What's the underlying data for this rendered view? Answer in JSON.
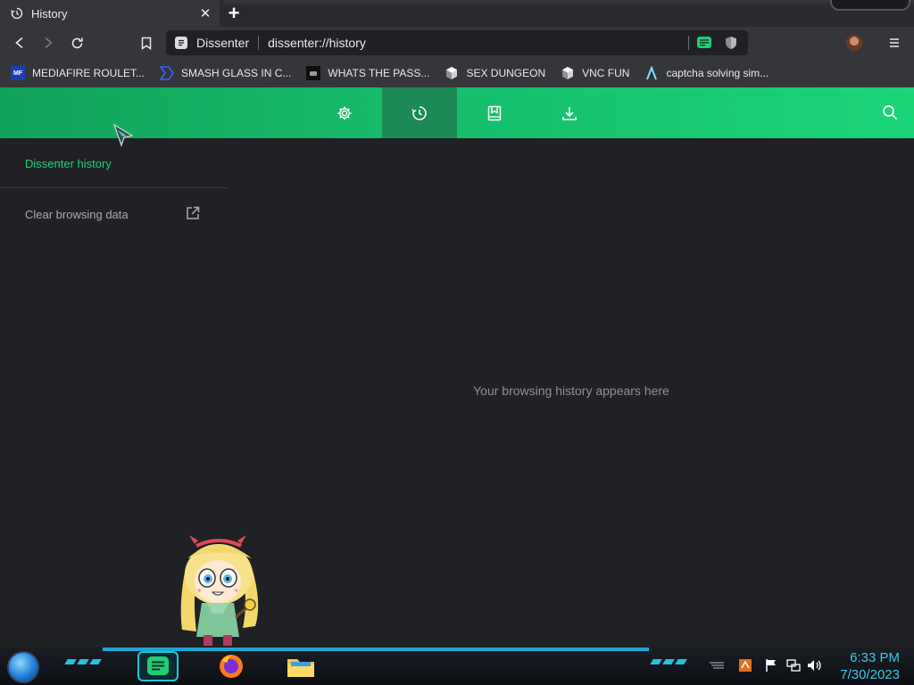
{
  "tab": {
    "title": "History",
    "close_icon": "close-icon"
  },
  "toolbar": {
    "site_label": "Dissenter",
    "url": "dissenter://history",
    "icons": [
      "back-icon",
      "forward-icon",
      "reload-icon",
      "bookmark-icon",
      "dissenter-extension-icon",
      "shield-icon",
      "avatar",
      "menu-icon"
    ]
  },
  "bookmarks": [
    {
      "label": "MEDIAFIRE ROULET...",
      "icon": "mediafire-icon"
    },
    {
      "label": "SMASH GLASS IN C...",
      "icon": "chevron-logo-icon"
    },
    {
      "label": "WHATS THE PASS...",
      "icon": "dark-square-icon"
    },
    {
      "label": "SEX DUNGEON",
      "icon": "cube-icon"
    },
    {
      "label": "VNC FUN",
      "icon": "cube-icon"
    },
    {
      "label": "captcha solving sim...",
      "icon": "lambda-icon"
    }
  ],
  "nav": {
    "title": "Dissenter history",
    "clear_label": "Clear browsing data"
  },
  "header_icons": [
    "settings-icon",
    "history-icon",
    "bookmarks-icon",
    "downloads-icon",
    "search-icon"
  ],
  "empty_message": "Your browsing history appears here",
  "clock": {
    "time": "6:33 PM",
    "date": "7/30/2023"
  },
  "colors": {
    "accent": "#16b968",
    "accent_active": "#1b8a55",
    "nav_title": "#21d07a",
    "background": "#202124"
  }
}
